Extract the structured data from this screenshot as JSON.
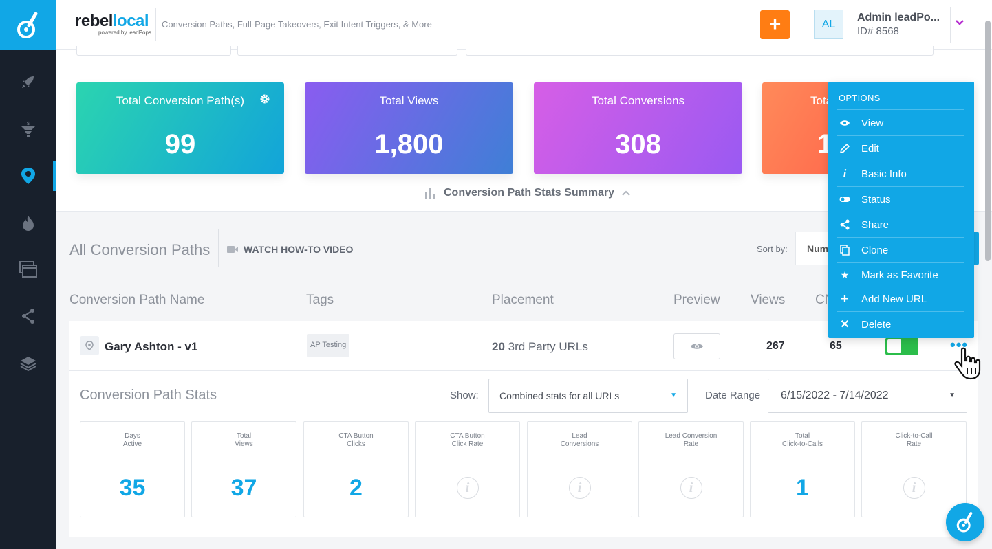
{
  "header": {
    "brand_part1": "rebel",
    "brand_part2": "local",
    "brand_powered": "powered by leadPops",
    "tagline": "Conversion Paths, Full-Page Takeovers, Exit Intent Triggers, & More",
    "add_label": "+",
    "avatar_initials": "AL",
    "user_name": "Admin leadPo...",
    "user_id": "ID# 8568"
  },
  "stat_cards": [
    {
      "label": "Total Conversion Path(s)",
      "value": "99"
    },
    {
      "label": "Total Views",
      "value": "1,800"
    },
    {
      "label": "Total Conversions",
      "value": "308"
    },
    {
      "label": "Tota",
      "value": "1"
    }
  ],
  "summary_toggle": "Conversion Path Stats Summary",
  "list": {
    "title": "All Conversion Paths",
    "watch_label": "WATCH HOW-TO VIDEO",
    "sort_label": "Sort by:",
    "sort_value": "Num",
    "columns": [
      "Conversion Path Name",
      "Tags",
      "Placement",
      "Preview",
      "Views",
      "CN"
    ]
  },
  "row": {
    "name": "Gary Ashton - v1",
    "tag": "AP Testing",
    "placement_count": "20",
    "placement_text": "3rd Party URLs",
    "views": "267",
    "conversions": "65",
    "status_on": true
  },
  "row_stats": {
    "title": "Conversion Path Stats",
    "show_label": "Show:",
    "show_value": "Combined stats for all URLs",
    "date_label": "Date Range",
    "date_value": "6/15/2022 - 7/14/2022",
    "tiles": [
      {
        "label": "Days\nActive",
        "value": "35"
      },
      {
        "label": "Total\nViews",
        "value": "37"
      },
      {
        "label": "CTA Button\nClicks",
        "value": "2"
      },
      {
        "label": "CTA Button\nClick Rate",
        "value": null
      },
      {
        "label": "Lead\nConversions",
        "value": null
      },
      {
        "label": "Lead Conversion\nRate",
        "value": null
      },
      {
        "label": "Total\nClick-to-Calls",
        "value": "1"
      },
      {
        "label": "Click-to-Call\nRate",
        "value": null
      }
    ]
  },
  "options_menu": {
    "title": "OPTIONS",
    "items": [
      {
        "label": "View",
        "icon": "eye-icon"
      },
      {
        "label": "Edit",
        "icon": "pencil-icon"
      },
      {
        "label": "Basic Info",
        "icon": "info-icon"
      },
      {
        "label": "Status",
        "icon": "toggle-icon"
      },
      {
        "label": "Share",
        "icon": "share-icon"
      },
      {
        "label": "Clone",
        "icon": "clone-icon"
      },
      {
        "label": "Mark as Favorite",
        "icon": "star-icon"
      },
      {
        "label": "Add New URL",
        "icon": "plus-icon"
      },
      {
        "label": "Delete",
        "icon": "close-icon"
      }
    ]
  },
  "colors": {
    "accent": "#11a7e6",
    "sidebar": "#18202c",
    "add_button": "#ff7d13",
    "toggle_on": "#2bbd4a"
  }
}
